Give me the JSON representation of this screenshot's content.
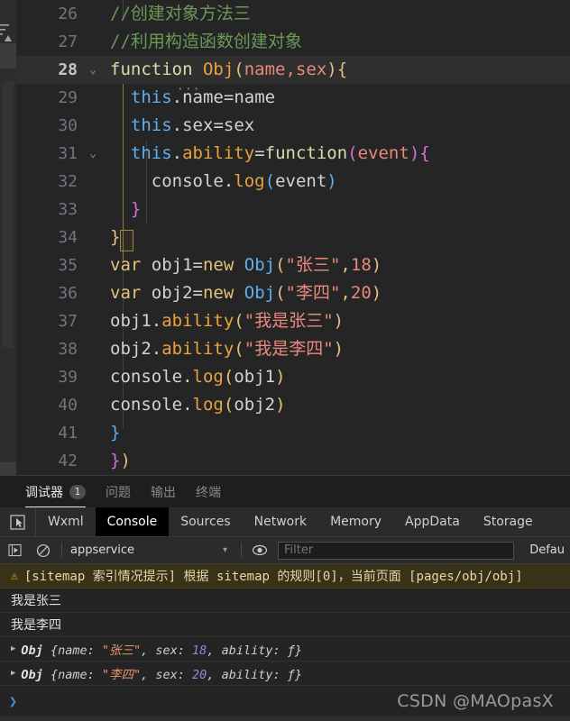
{
  "editor": {
    "lines": [
      {
        "num": "26",
        "fold": "",
        "active": false,
        "tokens": [
          {
            "t": "//创建对象方法三",
            "c": "cm"
          }
        ]
      },
      {
        "num": "27",
        "fold": "",
        "active": false,
        "tokens": [
          {
            "t": "//利用构造函数创建对象",
            "c": "cm"
          }
        ]
      },
      {
        "num": "28",
        "fold": "⌄",
        "active": true,
        "tokens": [
          {
            "t": "function ",
            "c": "fn"
          },
          {
            "t": "Obj",
            "c": "orange"
          },
          {
            "t": "(",
            "c": "p1"
          },
          {
            "t": "name",
            "c": "str"
          },
          {
            "t": ",",
            "c": "str"
          },
          {
            "t": "sex",
            "c": "str"
          },
          {
            "t": ")",
            "c": "p1"
          },
          {
            "t": "{",
            "c": "p1"
          }
        ]
      },
      {
        "num": "29",
        "fold": "",
        "active": false,
        "tokens": [
          {
            "t": "  ",
            "c": "op"
          },
          {
            "t": "this",
            "c": "blue"
          },
          {
            "t": ".",
            "c": "op"
          },
          {
            "t": "name",
            "c": "plain"
          },
          {
            "t": "=",
            "c": "op"
          },
          {
            "t": "name",
            "c": "plain"
          }
        ]
      },
      {
        "num": "30",
        "fold": "",
        "active": false,
        "tokens": [
          {
            "t": "  ",
            "c": "op"
          },
          {
            "t": "this",
            "c": "blue"
          },
          {
            "t": ".",
            "c": "op"
          },
          {
            "t": "sex",
            "c": "plain"
          },
          {
            "t": "=",
            "c": "op"
          },
          {
            "t": "sex",
            "c": "plain"
          }
        ]
      },
      {
        "num": "31",
        "fold": "⌄",
        "active": false,
        "tokens": [
          {
            "t": "  ",
            "c": "op"
          },
          {
            "t": "this",
            "c": "blue"
          },
          {
            "t": ".",
            "c": "op"
          },
          {
            "t": "ability",
            "c": "orange"
          },
          {
            "t": "=",
            "c": "op"
          },
          {
            "t": "function",
            "c": "fn"
          },
          {
            "t": "(",
            "c": "p2"
          },
          {
            "t": "event",
            "c": "str"
          },
          {
            "t": ")",
            "c": "p2"
          },
          {
            "t": "{",
            "c": "p2"
          }
        ]
      },
      {
        "num": "32",
        "fold": "",
        "active": false,
        "tokens": [
          {
            "t": "    ",
            "c": "op"
          },
          {
            "t": "console",
            "c": "plain"
          },
          {
            "t": ".",
            "c": "op"
          },
          {
            "t": "log",
            "c": "orange"
          },
          {
            "t": "(",
            "c": "p3"
          },
          {
            "t": "event",
            "c": "plain"
          },
          {
            "t": ")",
            "c": "p3"
          }
        ]
      },
      {
        "num": "33",
        "fold": "",
        "active": false,
        "tokens": [
          {
            "t": "  ",
            "c": "op"
          },
          {
            "t": "}",
            "c": "p2"
          }
        ]
      },
      {
        "num": "34",
        "fold": "",
        "active": false,
        "tokens": [
          {
            "t": "}",
            "c": "p1"
          }
        ]
      },
      {
        "num": "35",
        "fold": "",
        "active": false,
        "tokens": [
          {
            "t": "var ",
            "c": "kw"
          },
          {
            "t": "obj1",
            "c": "plain"
          },
          {
            "t": "=",
            "c": "op"
          },
          {
            "t": "new ",
            "c": "kw"
          },
          {
            "t": "Obj",
            "c": "blue"
          },
          {
            "t": "(",
            "c": "p1"
          },
          {
            "t": "\"张三\"",
            "c": "str"
          },
          {
            "t": ",",
            "c": "p1"
          },
          {
            "t": "18",
            "c": "num"
          },
          {
            "t": ")",
            "c": "p1"
          }
        ]
      },
      {
        "num": "36",
        "fold": "",
        "active": false,
        "tokens": [
          {
            "t": "var ",
            "c": "kw"
          },
          {
            "t": "obj2",
            "c": "plain"
          },
          {
            "t": "=",
            "c": "op"
          },
          {
            "t": "new ",
            "c": "kw"
          },
          {
            "t": "Obj",
            "c": "blue"
          },
          {
            "t": "(",
            "c": "p1"
          },
          {
            "t": "\"李四\"",
            "c": "str"
          },
          {
            "t": ",",
            "c": "p1"
          },
          {
            "t": "20",
            "c": "num"
          },
          {
            "t": ")",
            "c": "p1"
          }
        ]
      },
      {
        "num": "37",
        "fold": "",
        "active": false,
        "tokens": [
          {
            "t": "obj1",
            "c": "plain"
          },
          {
            "t": ".",
            "c": "op"
          },
          {
            "t": "ability",
            "c": "orange"
          },
          {
            "t": "(",
            "c": "p1"
          },
          {
            "t": "\"我是张三\"",
            "c": "str"
          },
          {
            "t": ")",
            "c": "p1"
          }
        ]
      },
      {
        "num": "38",
        "fold": "",
        "active": false,
        "tokens": [
          {
            "t": "obj2",
            "c": "plain"
          },
          {
            "t": ".",
            "c": "op"
          },
          {
            "t": "ability",
            "c": "orange"
          },
          {
            "t": "(",
            "c": "p1"
          },
          {
            "t": "\"我是李四\"",
            "c": "str"
          },
          {
            "t": ")",
            "c": "p1"
          }
        ]
      },
      {
        "num": "39",
        "fold": "",
        "active": false,
        "tokens": [
          {
            "t": "console",
            "c": "plain"
          },
          {
            "t": ".",
            "c": "op"
          },
          {
            "t": "log",
            "c": "orange"
          },
          {
            "t": "(",
            "c": "p1"
          },
          {
            "t": "obj1",
            "c": "plain"
          },
          {
            "t": ")",
            "c": "p1"
          }
        ]
      },
      {
        "num": "40",
        "fold": "",
        "active": false,
        "tokens": [
          {
            "t": "console",
            "c": "plain"
          },
          {
            "t": ".",
            "c": "op"
          },
          {
            "t": "log",
            "c": "orange"
          },
          {
            "t": "(",
            "c": "p1"
          },
          {
            "t": "obj2",
            "c": "plain"
          },
          {
            "t": ")",
            "c": "p1"
          }
        ]
      },
      {
        "num": "41",
        "fold": "",
        "active": false,
        "tokens": [
          {
            "t": "}",
            "c": "p3"
          }
        ]
      },
      {
        "num": "42",
        "fold": "",
        "active": false,
        "tokens": [
          {
            "t": "}",
            "c": "p2"
          },
          {
            "t": ")",
            "c": "p1"
          }
        ]
      }
    ]
  },
  "panel": {
    "tabs": [
      {
        "label": "调试器",
        "badge": "1",
        "selected": true
      },
      {
        "label": "问题",
        "badge": "",
        "selected": false
      },
      {
        "label": "输出",
        "badge": "",
        "selected": false
      },
      {
        "label": "终端",
        "badge": "",
        "selected": false
      }
    ]
  },
  "devtools": {
    "inspect_icon": "inspect-element-icon",
    "tabs": [
      {
        "label": "Wxml",
        "selected": false
      },
      {
        "label": "Console",
        "selected": true
      },
      {
        "label": "Sources",
        "selected": false
      },
      {
        "label": "Network",
        "selected": false
      },
      {
        "label": "Memory",
        "selected": false
      },
      {
        "label": "AppData",
        "selected": false
      },
      {
        "label": "Storage",
        "selected": false
      }
    ]
  },
  "console_toolbar": {
    "execute_icon": "execute-step-icon",
    "clear_icon": "clear-console-icon",
    "context_value": "appservice",
    "context_caret": "▾",
    "eye_icon": "eye-icon",
    "filter_placeholder": "Filter",
    "filter_value": "",
    "levels_label": "Defau"
  },
  "console_rows": {
    "warning": {
      "icon": "warning-triangle-icon",
      "text": "[sitemap 索引情况提示] 根据 sitemap 的规则[0]，当前页面 [pages/obj/obj]"
    },
    "logs": [
      {
        "type": "text",
        "text": "我是张三"
      },
      {
        "type": "text",
        "text": "我是李四"
      },
      {
        "type": "object",
        "disclosure": "▶",
        "ctor": "Obj",
        "open": "{",
        "k1": "name: ",
        "v1": "\"张三\"",
        "sep1": ", ",
        "k2": "sex: ",
        "v2": "18",
        "sep2": ", ",
        "k3": "ability: ",
        "v3": "ƒ",
        "close": "}"
      },
      {
        "type": "object",
        "disclosure": "▶",
        "ctor": "Obj",
        "open": "{",
        "k1": "name: ",
        "v1": "\"李四\"",
        "sep1": ", ",
        "k2": "sex: ",
        "v2": "20",
        "sep2": ", ",
        "k3": "ability: ",
        "v3": "ƒ",
        "close": "}"
      }
    ],
    "prompt_chevron": "❯"
  },
  "watermark": {
    "text": "CSDN @MAOpasX"
  },
  "colors": {
    "editor_bg": "#252526",
    "panel_bg": "#1e1e1e",
    "console_bg": "#242424",
    "warning_bg": "#373218",
    "accent_blue": "#61afef",
    "string_red": "#e8897d",
    "comment_green": "#6a9955",
    "keyword_yellow": "#e5c07b"
  }
}
